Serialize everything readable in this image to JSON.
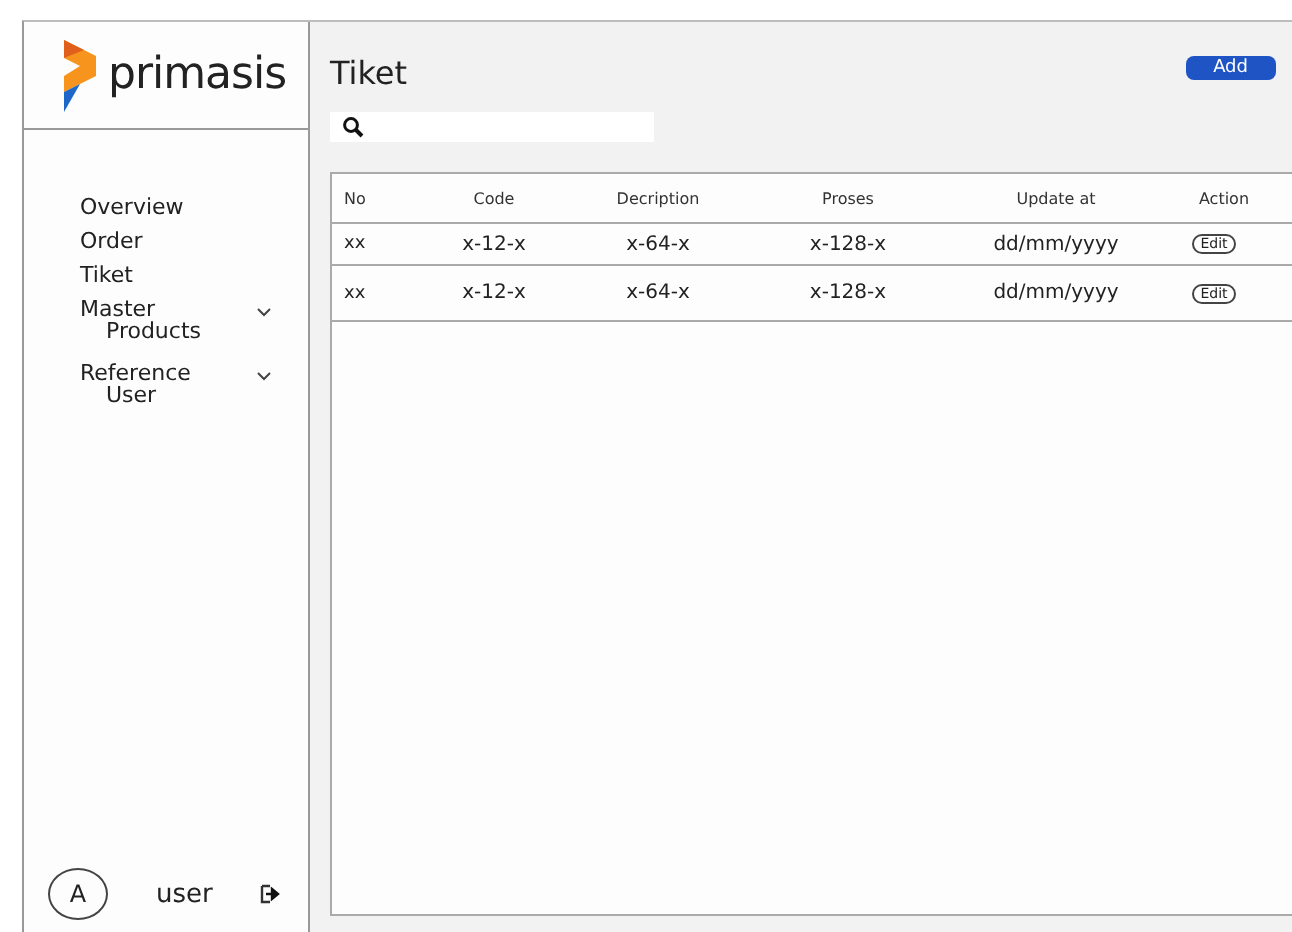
{
  "brand": {
    "name": "primasis"
  },
  "sidebar": {
    "items": [
      {
        "label": "Overview"
      },
      {
        "label": "Order"
      },
      {
        "label": "Tiket"
      },
      {
        "label": "Master",
        "expanded": true,
        "children": [
          {
            "label": "Products"
          }
        ]
      },
      {
        "label": "Reference",
        "expanded": true,
        "children": [
          {
            "label": "User"
          }
        ]
      }
    ]
  },
  "user": {
    "avatar": "A",
    "name": "user"
  },
  "page": {
    "title": "Tiket",
    "add_button": "Add"
  },
  "table": {
    "columns": [
      "No",
      "Code",
      "Decription",
      "Proses",
      "Update at",
      "Action"
    ],
    "rows": [
      {
        "cells": [
          "xx",
          "x-12-x",
          "x-64-x",
          "x-128-x",
          "dd/mm/yyyy"
        ],
        "action": "Edit"
      },
      {
        "cells": [
          "xx",
          "x-12-x",
          "x-64-x",
          "x-128-x",
          "dd/mm/yyyy"
        ],
        "action": "Edit"
      }
    ]
  }
}
